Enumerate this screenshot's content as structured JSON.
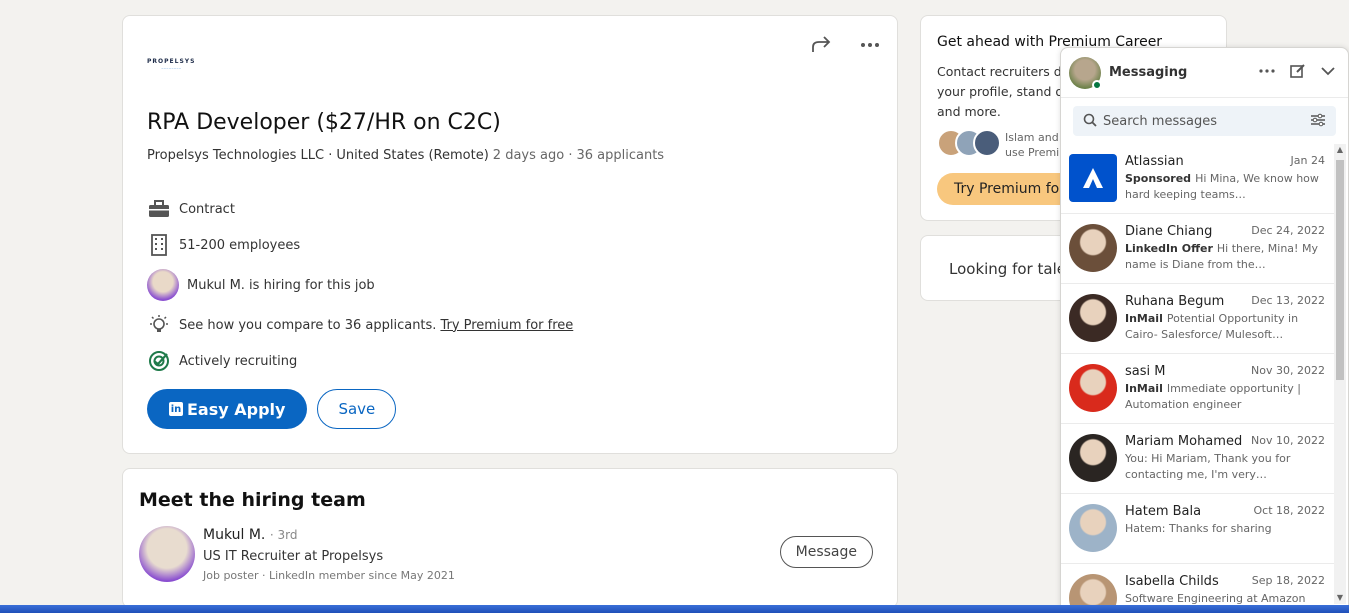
{
  "job": {
    "company_logo_text": "PROPELSYS",
    "title": "RPA Developer ($27/HR on C2C)",
    "company": "Propelsys Technologies LLC ·",
    "location": "United States (Remote)",
    "posted": "2 days ago ·",
    "applicants": "36 applicants",
    "insights": {
      "type": "Contract",
      "size": "51-200 employees",
      "hiring": "Mukul M. is hiring for this job",
      "compare": "See how you compare to 36 applicants.",
      "compare_link": "Try Premium for free",
      "recruiting": "Actively recruiting"
    },
    "easy_apply_label": "Easy Apply",
    "save_label": "Save"
  },
  "team": {
    "title": "Meet the hiring team",
    "name": "Mukul M.",
    "degree": "· 3rd",
    "headline": "US IT Recruiter at Propelsys",
    "sub": "Job poster · LinkedIn member since May 2021",
    "message_label": "Message"
  },
  "premium": {
    "title": "Get ahead with Premium Career",
    "body": "Contact recruiters di your profile, stand o and more.",
    "social": "Islam and use Premiu",
    "button": "Try Premium fo"
  },
  "looking": {
    "text": "Looking for taler"
  },
  "messaging": {
    "title": "Messaging",
    "search_placeholder": "Search messages",
    "conversations": [
      {
        "name": "Atlassian",
        "date": "Jan 24",
        "tag": "Sponsored",
        "snippet": "Hi Mina, We know how hard keeping teams…",
        "color": "#0052cc"
      },
      {
        "name": "Diane Chiang",
        "date": "Dec 24, 2022",
        "tag": "LinkedIn Offer",
        "snippet": "Hi there, Mina! My name is Diane from the…",
        "color": "#6b4f3a"
      },
      {
        "name": "Ruhana Begum",
        "date": "Dec 13, 2022",
        "tag": "InMail",
        "snippet": "Potential Opportunity in Cairo- Salesforce/ Mulesoft…",
        "color": "#3b2a24"
      },
      {
        "name": "sasi M",
        "date": "Nov 30, 2022",
        "tag": "InMail",
        "snippet": "Immediate opportunity | Automation engineer",
        "color": "#d92a1c"
      },
      {
        "name": "Mariam Mohamed",
        "date": "Nov 10, 2022",
        "tag": "",
        "snippet": "You: Hi Mariam, Thank you for contacting me, I'm very…",
        "color": "#2a2522"
      },
      {
        "name": "Hatem Bala",
        "date": "Oct 18, 2022",
        "tag": "",
        "snippet": "Hatem: Thanks for sharing",
        "color": "#9db3c8"
      },
      {
        "name": "Isabella Childs",
        "date": "Sep 18, 2022",
        "tag": "",
        "snippet": "Software Engineering at Amazon",
        "color": "#b89574"
      }
    ]
  }
}
